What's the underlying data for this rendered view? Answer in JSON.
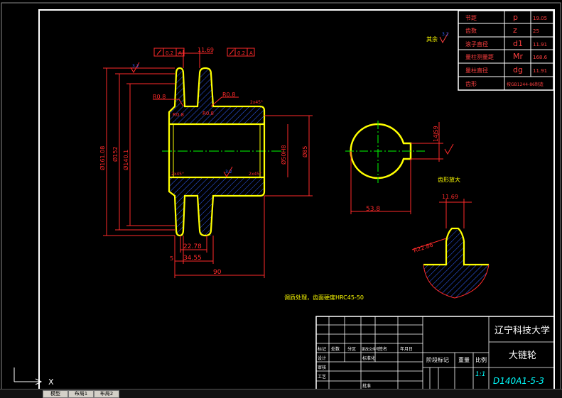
{
  "spec_table": [
    {
      "name": "节距",
      "symbol": "p",
      "value": "19.05"
    },
    {
      "name": "齿数",
      "symbol": "z",
      "value": "25"
    },
    {
      "name": "滚子直径",
      "symbol": "d1",
      "value": "11.91"
    },
    {
      "name": "量柱测量距",
      "symbol": "Mr",
      "value": "168.6"
    },
    {
      "name": "量柱直径",
      "symbol": "dg",
      "value": "11.91"
    },
    {
      "name": "齿形",
      "symbol": "",
      "value": "按GB1244-86制造"
    }
  ],
  "dims": {
    "top_width": "11.69",
    "tol_left": "0.2",
    "tol_left_ref": "A",
    "tol_right": "0.2",
    "tol_right_ref": "A",
    "r08_a": "R0.8",
    "r08_b": "R0.8",
    "r08_c": "R0.8",
    "r08_d": "R0.8",
    "dia_tip": "Ø161.08",
    "dia_152": "Ø152",
    "dia_root": "Ø140.1",
    "dia_bore": "Ø50H8",
    "dia_85": "Ø85",
    "d_2278": "22.78",
    "d_5": "5",
    "d_3455": "34.55",
    "d_90": "90",
    "keyway_w": "14JS9",
    "keyway_h": "53.8",
    "tooth_w": "11.69",
    "tooth_r": "R22.86",
    "chamfer": "2x45°",
    "rough": "3.2",
    "rough_other": "其余"
  },
  "labels": {
    "tooth_detail": "齿形放大",
    "heat_treat": "调质处理，齿面硬度HRC45-50",
    "school": "辽宁科技大学",
    "part_name": "大链轮",
    "drawing_no": "D140A1-5-3",
    "scale": "1:1",
    "stage_mark": "阶段标记",
    "weight": "重量",
    "ratio": "比例",
    "tb_mark": "标记",
    "tb_count": "处数",
    "tb_zone": "分区",
    "tb_doc": "更改文件号",
    "tb_sign": "签名",
    "tb_date": "年月日",
    "tb_design": "设计",
    "tb_std": "标准化",
    "tb_review": "审核",
    "tb_craft": "工艺",
    "tb_approve": "批准"
  },
  "ui": {
    "axis_x": "X",
    "tab1": "模型",
    "tab2": "布局1",
    "tab3": "布局2"
  },
  "colors": {
    "background": "#000000",
    "outline": "#ffff00",
    "dimension": "#ff2a2a",
    "hatch": "#3060ff",
    "center": "#00ff00",
    "table_text": "#ff4040",
    "title_text": "#00ffff",
    "frame": "#ffffff"
  }
}
